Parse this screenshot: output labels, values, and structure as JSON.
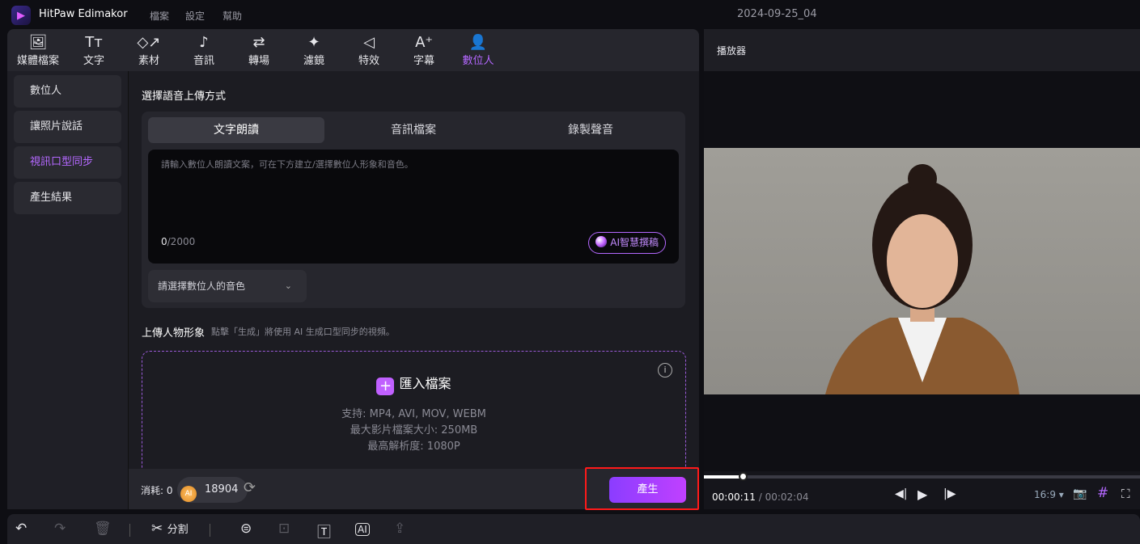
{
  "app": {
    "name": "HitPaw Edimakor",
    "menus": [
      "檔案",
      "設定",
      "幫助"
    ],
    "document_title": "2024-09-25_04"
  },
  "nav": [
    {
      "label": "媒體檔案",
      "icon": "media-icon"
    },
    {
      "label": "文字",
      "icon": "text-icon"
    },
    {
      "label": "素材",
      "icon": "elements-icon"
    },
    {
      "label": "音訊",
      "icon": "music-icon"
    },
    {
      "label": "轉場",
      "icon": "transition-icon"
    },
    {
      "label": "濾鏡",
      "icon": "filter-icon"
    },
    {
      "label": "特效",
      "icon": "effects-icon"
    },
    {
      "label": "字幕",
      "icon": "subtitle-icon"
    },
    {
      "label": "數位人",
      "icon": "avatar-icon",
      "active": true
    }
  ],
  "sidebar": [
    {
      "label": "數位人"
    },
    {
      "label": "讓照片說話"
    },
    {
      "label": "視訊口型同步",
      "active": true
    },
    {
      "label": "產生結果"
    }
  ],
  "main": {
    "section1_title": "選擇語音上傳方式",
    "tabs": [
      {
        "label": "文字朗讀",
        "active": true
      },
      {
        "label": "音訊檔案"
      },
      {
        "label": "錄製聲音"
      }
    ],
    "text_placeholder": "請輸入數位人朗讀文案，可在下方建立/選擇數位人形象和音色。",
    "char_count": "0",
    "char_limit": "/2000",
    "ai_write_label": "AI智慧撰稿",
    "voice_select": "請選擇數位人的音色",
    "section2_title": "上傳人物形象",
    "section2_hint": "點擊「生成」將使用 AI 生成口型同步的視頻。",
    "import_label": "匯入檔案",
    "support": "支持: MP4, AVI, MOV, WEBM",
    "max_size": "最大影片檔案大小: 250MB",
    "max_res": "最高解析度: 1080P"
  },
  "footer": {
    "cost_label": "消耗: 0",
    "coin_badge": "AI",
    "credits": "18904",
    "generate_label": "產生"
  },
  "player": {
    "title": "播放器",
    "current_time": "00:00:11",
    "total_time": "/ 00:02:04",
    "progress": 0.089,
    "aspect": "16:9 ▾"
  },
  "toolbar": {
    "split_label": "分割"
  },
  "colors": {
    "accent": "#b468ff",
    "highlight_box": "#ff1a1a"
  }
}
